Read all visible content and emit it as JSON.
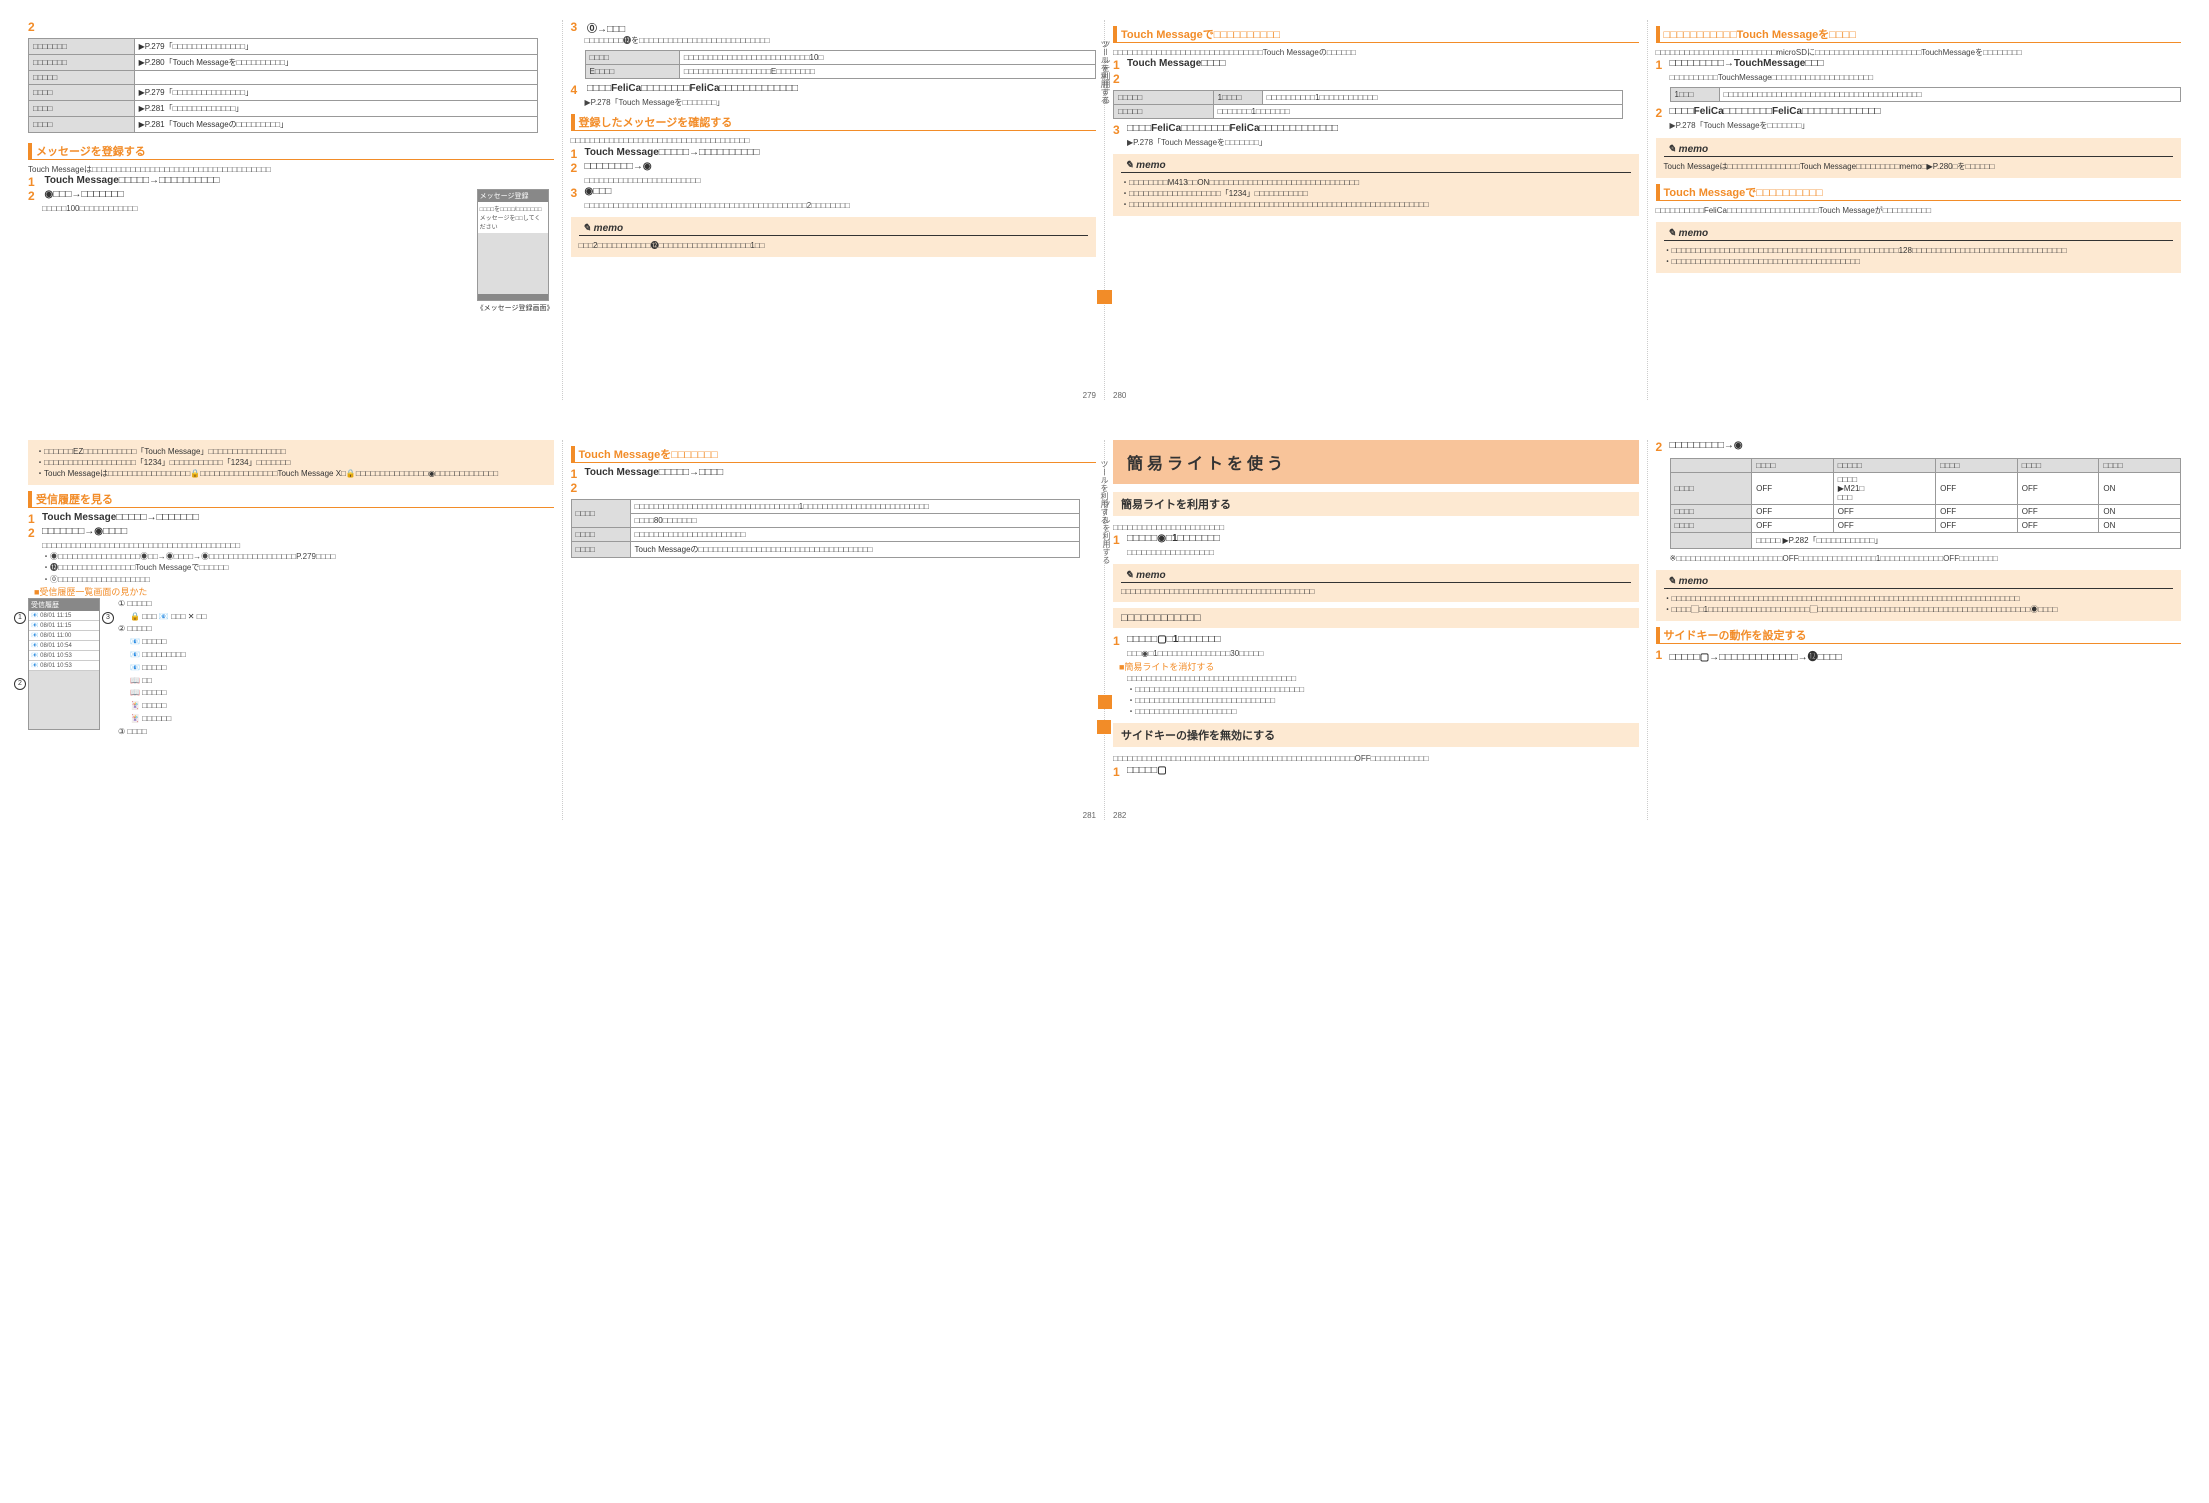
{
  "pages": {
    "p279": {
      "num": "279",
      "tbl": {
        "r1c1": "□□□□□□□",
        "r1c2": "▶P.279「□□□□□□□□□□□□□□□」",
        "r2c1": "□□□□□□□",
        "r2c2": "▶P.280「Touch Messageを□□□□□□□□□□」",
        "r3c1": "□□□□□",
        "r3c2": "",
        "r4c1": "□□□□",
        "r4c2": "▶P.279「□□□□□□□□□□□□□□□」",
        "r5c1": "□□□□",
        "r5c2": "▶P.281「□□□□□□□□□□□□□」",
        "r6c1": "□□□□",
        "r6c2": "▶P.281「Touch Messageの□□□□□□□□□」"
      },
      "hdr1": "メッセージを登録する",
      "intro1": "Touch Messageは□□□□□□□□□□□□□□□□□□□□□□□□□□□□□□□□□□□□□",
      "s1": "Touch Message□□□□□→□□□□□□□□□□",
      "s2": "◉□□□→□□□□□□□",
      "s2note": "□□□□□100□□□□□□□□□□□□",
      "shot_hdr": "メッセージ登録",
      "shot_body": "□□□□を□□□□/□□□□□□□メッセージを□□してください",
      "shot_caption": "《メッセージ登録画面》",
      "rcol_s3": "⓪→□□□",
      "rcol_s3_note": "□□□□□□□□⓬を□□□□□□□□□□□□□□□□□□□□□□□□□□□",
      "rcol_tbl": {
        "th1": "□□□□",
        "r1": "□□□□□□□□□□□□□□□□□□□□□□□□□□10□",
        "r2h": "E□□□□",
        "r2": "□□□□□□□□□□□□□□□□□□E□□□□□□□□"
      },
      "rcol_s4": "□□□□FeliCa□□□□□□□□FeliCa□□□□□□□□□□□□□",
      "rcol_s4_note": "▶P.278「Touch Messageを□□□□□□□」",
      "rcol_hdr2": "登録したメッセージを確認する",
      "rcol_intro2": "□□□□□□□□□□□□□□□□□□□□□□□□□□□□□□□□□□□□□",
      "rcol_s2_1": "Touch Message□□□□□→□□□□□□□□□□",
      "rcol_s2_2": "□□□□□□□□→◉",
      "rcol_s2_2note": "□□□□□□□□□□□□□□□□□□□□□□□□",
      "rcol_s2_3": "◉□□□",
      "rcol_s2_3note": "□□□□□□□□□□□□□□□□□□□□□□□□□□□□□□□□□□□□□□□□□□□□□□2□□□□□□□□",
      "memo1": "□□□2□□□□□□□□□□□⓬□□□□□□□□□□□□□□□□□□□1□□"
    },
    "p280": {
      "num": "280",
      "hdr1": "Touch Messageで□□□□□□□□□□",
      "intro1": "□□□□□□□□□□□□□□□□□□□□□□□□□□□□□□□Touch Messageの□□□□□□",
      "s1": "Touch Message□□□□",
      "tbl": {
        "r1h": "□□□□□",
        "r1c1": "1□□□□",
        "r1c2": "□□□□□□□□□□1□□□□□□□□□□□□",
        "r2h": "□□□□□",
        "r2": "□□□□□□□1□□□□□□□"
      },
      "s3": "□□□□FeliCa□□□□□□□□FeliCa□□□□□□□□□□□□□",
      "s3note": "▶P.278「Touch Messageを□□□□□□□」",
      "memo": "・□□□□□□□□M413□□ON□□□□□□□□□□□□□□□□□□□□□□□□□□□□□□□\n・□□□□□□□□□□□□□□□□□□□「1234」□□□□□□□□□□□\n・□□□□□□□□□□□□□□□□□□□□□□□□□□□□□□□□□□□□□□□□□□□□□□□□□□□□□□□□□□□□□□",
      "rcol_hdr1": "□□□□□□□□□□□Touch Messageを□□□□",
      "rcol_intro1": "□□□□□□□□□□□□□□□□□□□□□□□□□microSDに□□□□□□□□□□□□□□□□□□□□□□TouchMessageを□□□□□□□□",
      "rcol_s1": "□□□□□□□□□→TouchMessage□□□",
      "rcol_s1_note": "□□□□□□□□□□TouchMessage□□□□□□□□□□□□□□□□□□□□□",
      "rcol_tbl": {
        "h": "1□□□",
        "c": "□□□□□□□□□□□□□□□□□□□□□□□□□□□□□□□□□□□□□□□□□"
      },
      "rcol_s2": "□□□□FeliCa□□□□□□□□FeliCa□□□□□□□□□□□□□",
      "rcol_s2_note": "▶P.278「Touch Messageを□□□□□□□」",
      "rcol_memo1": "Touch Messageは□□□□□□□□□□□□□□□Touch Message□□□□□□□□□memo□▶P.280□を□□□□□□",
      "rcol_hdr2": "Touch Messageで□□□□□□□□□□",
      "rcol_intro2": "□□□□□□□□□□FeliCa□□□□□□□□□□□□□□□□□□□Touch Messageが□□□□□□□□□□",
      "rcol_memo2": "・□□□□□□□□□□□□□□□□□□□□□□□□□□□□□□□□□□□□□□□□□□□□□□□128□□□□□□□□□□□□□□□□□□□□□□□□□□□□□□□□\n・□□□□□□□□□□□□□□□□□□□□□□□□□□□□□□□□□□□□□□□"
    },
    "p281": {
      "num": "281",
      "top_memo": "・□□□□□□EZ□□□□□□□□□□□「Touch Message」□□□□□□□□□□□□□□□□\n・□□□□□□□□□□□□□□□□□□□「1234」□□□□□□□□□□□「1234」□□□□□□□\n・Touch Messageは□□□□□□□□□□□□□□□□□🔒□□□□□□□□□□□□□□□□Touch Message X□🔒□□□□□□□□□□□□□□□◉□□□□□□□□□□□□□",
      "hdr1": "受信履歴を見る",
      "s1": "Touch Message□□□□□→□□□□□□□",
      "s2": "□□□□□□□→◉□□□□",
      "s2_body": "□□□□□□□□□□□□□□□□□□□□□□□□□□□□□□□□□□□□□□□□□\n・◉□□□□□□□□□□□□□□□□□◉□□→◉□□□□→◉□□□□□□□□□□□□□□□□□□P.279□□□□\n・⓬□□□□□□□□□□□□□□□□Touch Messageで□□□□□□\n・⓪□□□□□□□□□□□□□□□□□□□",
      "sub_orange": "■受信履歴一覧画面の見かた",
      "legend": {
        "l1": "① □□□□□",
        "l1b": "🔒 □□□ 📧 □□□ ✕ □□",
        "l2": "② □□□□□",
        "l2icons": "📧 □□□□□\n📧 □□□□□□□□□\n📧 □□□□□\n📖 □□\n📖 □□□□□\n🃏 □□□□□\n🃏 □□□□□□",
        "l3": "③ □□□□"
      },
      "rcol_hdr1": "Touch Messageを□□□□□□□",
      "rcol_s1": "Touch Message□□□□□→□□□□",
      "rcol_tbl": {
        "r1h": "□□□□",
        "r1": "□□□□□□□□□□□□□□□□□□□□□□□□□□□□□□□□□□1□□□□□□□□□□□□□□□□□□□□□□□□□□",
        "r2": "□□□□80□□□□□□□",
        "r3h": "□□□□",
        "r3": "□□□□□□□□□□□□□□□□□□□□□□□",
        "r4h": "□□□□",
        "r4": "Touch Messageの□□□□□□□□□□□□□□□□□□□□□□□□□□□□□□□□□□□□"
      }
    },
    "p282": {
      "num": "282",
      "banner": "簡易ライトを使う",
      "sub1": "簡易ライトを利用する",
      "intro1": "□□□□□□□□□□□□□□□□□□□□□□□",
      "s1": "□□□□□◉□1□□□□□□□",
      "s1_note": "□□□□□□□□□□□□□□□□□□",
      "memo1": "□□□□□□□□□□□□□□□□□□□□□□□□□□□□□□□□□□□□□□□□",
      "sub2": "□□□□□□□□□□□□",
      "s2_1": "□□□□□▢□1□□□□□□□",
      "s2_1_note": "□□□◉□1□□□□□□□□□□□□□□□30□□□□□",
      "sub_orange": "■簡易ライトを消灯する",
      "so_body": "□□□□□□□□□□□□□□□□□□□□□□□□□□□□□□□□□□□\n・□□□□□□□□□□□□□□□□□□□□□□□□□□□□□□□□□□□\n・□□□□□□□□□□□□□□□□□□□□□□□□□□□□□\n・□□□□□□□□□□□□□□□□□□□□□",
      "sub3": "サイドキーの操作を無効にする",
      "intro3": "□□□□□□□□□□□□□□□□□□□□□□□□□□□□□□□□□□□□□□□□□□□□□□□□□□OFF□□□□□□□□□□□□",
      "s3_1": "□□□□□▢",
      "rcol_s2": "□□□□□□□□□→◉",
      "rcol_tbl": {
        "hdrs": [
          "",
          "□□□□",
          "□□□□□",
          "□□□□",
          "□□□□",
          "□□□□"
        ],
        "r1": [
          "□□□□",
          "OFF",
          "□□□□\n▶M21□\n□□□",
          "OFF",
          "OFF",
          "ON"
        ],
        "r2": [
          "□□□□",
          "OFF",
          "OFF",
          "OFF",
          "OFF",
          "ON"
        ],
        "r3": [
          "□□□□",
          "OFF",
          "OFF",
          "OFF",
          "OFF",
          "ON"
        ],
        "foot": "□□□□□ ▶P.282「□□□□□□□□□□□□」"
      },
      "rcol_note": "※□□□□□□□□□□□□□□□□□□□□□□OFF□□□□□□□□□□□□□□□□1□□□□□□□□□□□□□OFF□□□□□□□□",
      "rcol_memo": "・□□□□□□□□□□□□□□□□□□□□□□□□□□□□□□□□□□□□□□□□□□□□□□□□□□□□□□□□□□□□□□□□□□□□□□□□\n・□□□□▢□1□□□□□□□□□□□□□□□□□□□□□▢□□□□□□□□□□□□□□□□□□□□□□□□□□□□□□□□□□□□□□□□□□□□◉□□□□",
      "rcol_hdr2": "サイドキーの動作を設定する",
      "rcol_s1": "□□□□□▢→□□□□□□□□□□□□□→⓬□□□□"
    }
  },
  "labels": {
    "memo": "memo"
  }
}
